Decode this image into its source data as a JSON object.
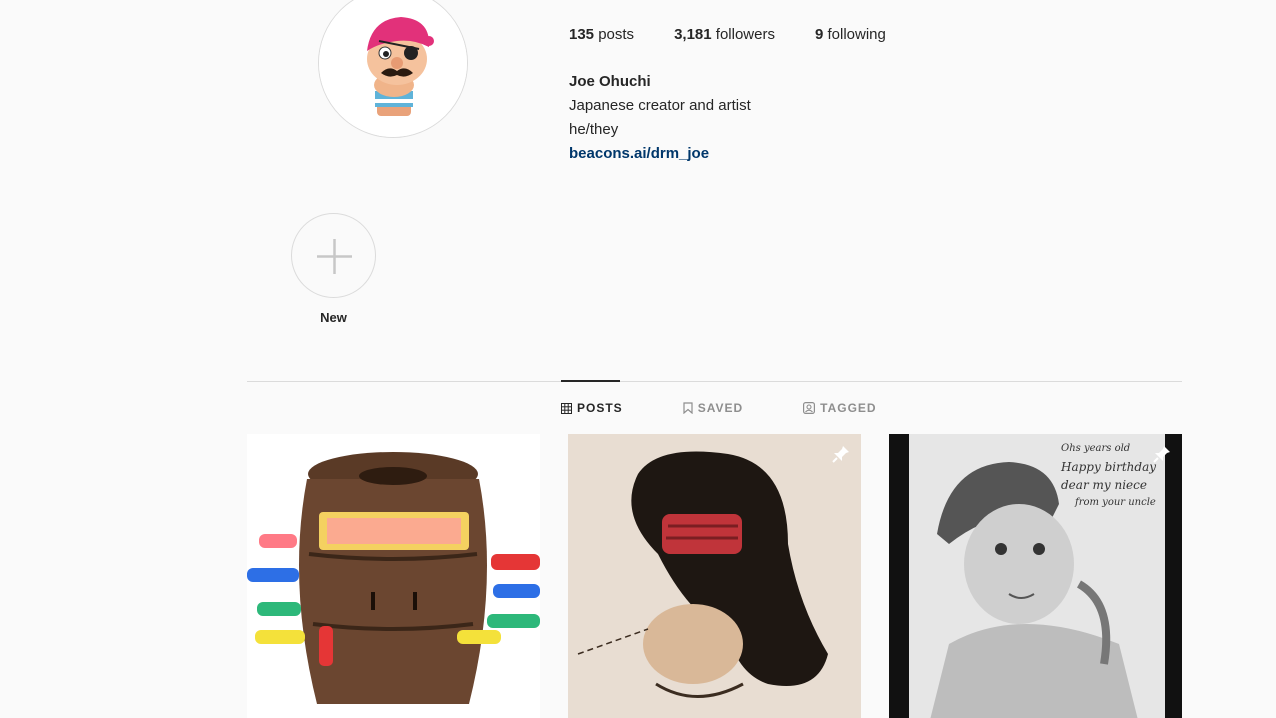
{
  "profile": {
    "posts_count": "135",
    "posts_label": "posts",
    "followers_count": "3,181",
    "followers_label": "followers",
    "following_count": "9",
    "following_label": "following",
    "name": "Joe Ohuchi",
    "bio_line1": "Japanese creator and artist",
    "bio_line2": "he/they",
    "link": "beacons.ai/drm_joe"
  },
  "highlights": {
    "new_label": "New"
  },
  "tabs": [
    {
      "label": "POSTS",
      "icon": "grid-icon",
      "active": true
    },
    {
      "label": "SAVED",
      "icon": "bookmark-icon",
      "active": false
    },
    {
      "label": "TAGGED",
      "icon": "tag-icon",
      "active": false
    }
  ],
  "posts": [
    {
      "subject": "pop-up pirate barrel toy",
      "pinned": false
    },
    {
      "subject": "spray paint portrait with red mask",
      "pinned": true
    },
    {
      "subject": "pencil drawing of baby with handwritten note",
      "pinned": true,
      "handwriting": [
        "Happy birthday",
        "dear my niece",
        "from your uncle",
        "Ohs years old"
      ]
    }
  ],
  "colors": {
    "link": "#00376b",
    "text": "#262626",
    "muted": "#8e8e8e",
    "border": "#dbdbdb",
    "bg": "#fafafa"
  }
}
